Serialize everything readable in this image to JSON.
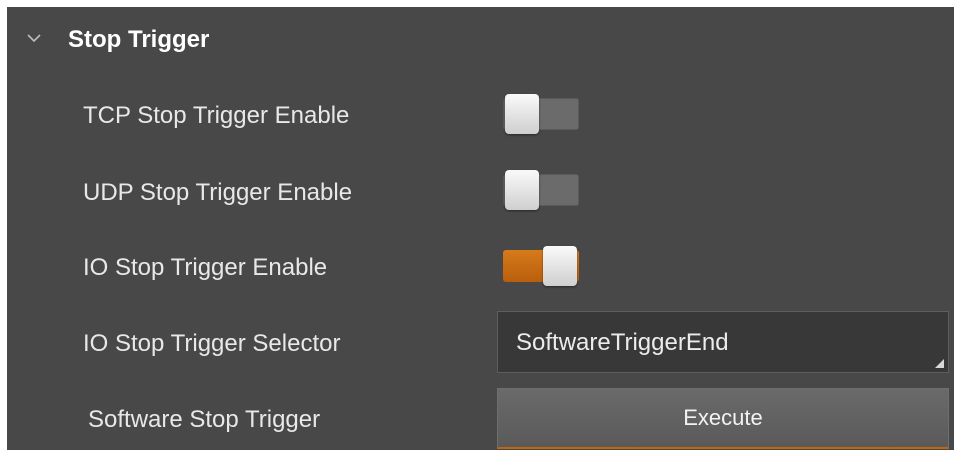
{
  "section": {
    "title": "Stop Trigger",
    "expanded": true,
    "chevron_icon": "chevron-down-icon"
  },
  "rows": [
    {
      "label": "TCP Stop Trigger Enable",
      "type": "toggle",
      "checked": false
    },
    {
      "label": "UDP Stop Trigger Enable",
      "type": "toggle",
      "checked": false
    },
    {
      "label": "IO Stop Trigger Enable",
      "type": "toggle",
      "checked": true
    },
    {
      "label": "IO Stop Trigger Selector",
      "type": "select",
      "value": "SoftwareTriggerEnd"
    },
    {
      "label": "Software Stop Trigger",
      "type": "button",
      "button_label": "Execute"
    }
  ],
  "colors": {
    "panel_background": "#484848",
    "toggle_on_accent": "#c8690f",
    "toggle_off_track": "#6b6b6b",
    "label_text": "#e8e8e8"
  }
}
